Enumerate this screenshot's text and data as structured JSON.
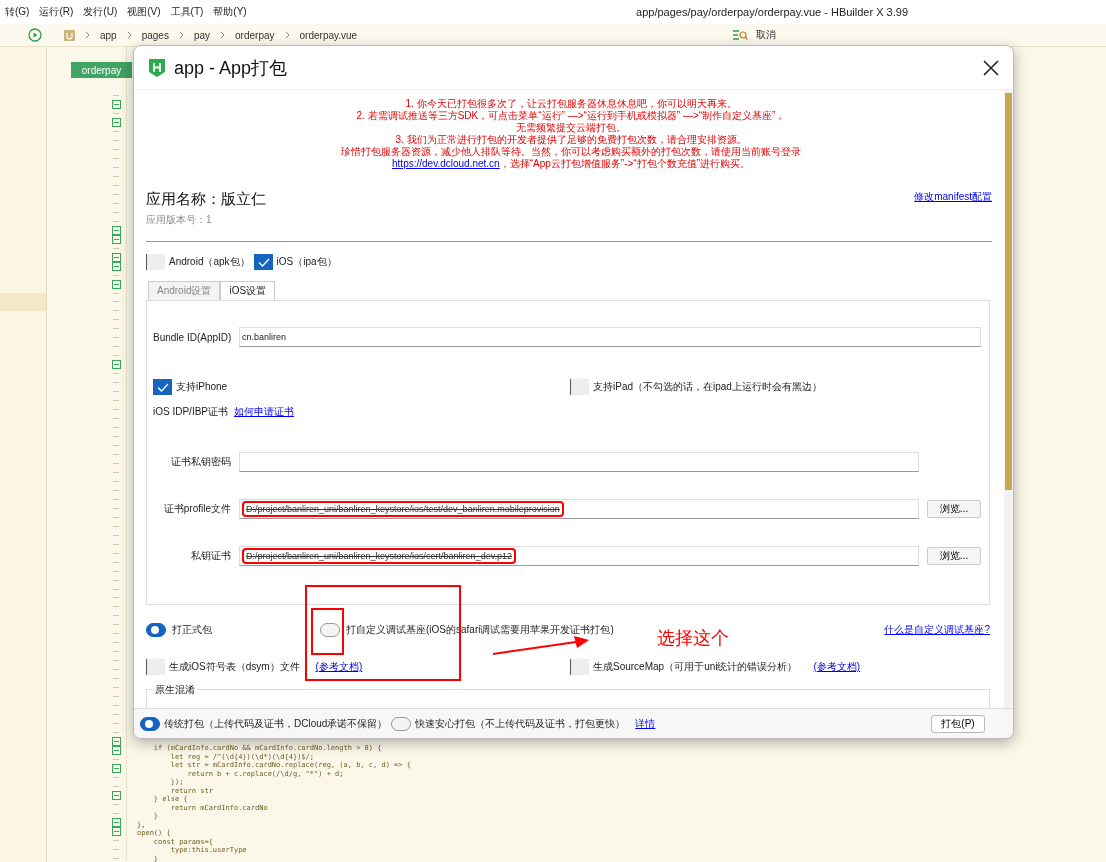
{
  "window": {
    "title": "app/pages/pay/orderpay/orderpay.vue - HBuilder X 3.99"
  },
  "menu": [
    "转(G)",
    "运行(R)",
    "发行(U)",
    "视图(V)",
    "工具(T)",
    "帮助(Y)"
  ],
  "breadcrumb": [
    "app",
    "pages",
    "pay",
    "orderpay",
    "orderpay.vue"
  ],
  "toolbar": {
    "cancel": "取消"
  },
  "editor": {
    "tab": "orderpay",
    "code": [
      "    if (mCardInfo.cardNo && mCardInfo.cardNo.length > 8) {",
      "        let reg = /^(\\d{4})(\\d*)(\\d{4})$/;",
      "        let str = mCardInfo.cardNo.replace(reg, (a, b, c, d) => {",
      "            return b + c.replace(/\\d/g, \"*\") + d;",
      "        });",
      "        return str",
      "    } else {",
      "        return mCardInfo.cardNo",
      "    }",
      "},",
      "open() {",
      "    const params={",
      "        type:this.userType",
      "    }"
    ]
  },
  "dialog": {
    "title": "app - App打包",
    "notice": [
      "1. 你今天已打包很多次了，让云打包服务器休息休息吧，你可以明天再来。",
      "2. 若需调试推送等三方SDK，可点击菜单“运行” —>“运行到手机或模拟器” —>“制作自定义基座”，",
      "无需频繁提交云端打包。",
      "3. 我们为正常进行打包的开发者提供了足够的免费打包次数，请合理安排资源。",
      "珍惜打包服务器资源，减少他人排队等待。当然，你可以考虑购买额外的打包次数，请使用当前账号登录"
    ],
    "notice_link": {
      "link": "https://dev.dcloud.net.cn",
      "text": "，选择“App云打包增值服务”->“打包个数充值”进行购买。"
    },
    "app_name": "应用名称：版立仁",
    "app_version": "应用版本号：1",
    "manifest_link": "修改manifest配置",
    "platforms": [
      {
        "label": "Android（apk包）",
        "checked": false
      },
      {
        "label": "iOS（ipa包）",
        "checked": true
      }
    ],
    "tabs": [
      {
        "label": "Android设置",
        "selected": false
      },
      {
        "label": "iOS设置",
        "selected": true
      }
    ],
    "bundle_id": {
      "label": "Bundle ID(AppID)",
      "value": "cn.banliren"
    },
    "devices": [
      {
        "label": "支持iPhone",
        "checked": true
      },
      {
        "label": "支持iPad（不勾选的话，在ipad上运行时会有黑边）",
        "checked": false
      }
    ],
    "certificate": {
      "label": "iOS IDP/IBP证书",
      "link": "如何申请证书"
    },
    "fields": [
      {
        "label": "证书私钥密码"
      },
      {
        "label": "证书profile文件",
        "value": "D:/project/banliren_uni/banliren_keystore/ios/test/dev_banliren.mobileprovision",
        "highlighted": true,
        "button": "浏览..."
      },
      {
        "label": "私钥证书",
        "value": "D:/project/banliren_uni/banliren_keystore/ios/cert/banliren_dev.p12",
        "highlighted": true,
        "button": "浏览..."
      }
    ],
    "build_types": [
      {
        "label": "打正式包",
        "selected": true
      },
      {
        "label": "打自定义调试基座(iOS的safari调试需要用苹果开发证书打包)",
        "selected": false
      }
    ],
    "build_help_link": "什么是自定义调试基座?",
    "extras": [
      {
        "label": "生成iOS符号表（dsym）文件",
        "link": "(参考文档)",
        "checked": false
      },
      {
        "label": "生成SourceMap（可用于uni统计的错误分析）",
        "link": "(参考文档)",
        "checked": false
      }
    ],
    "obfuscation": {
      "legend": "原生混淆"
    },
    "upload_modes": [
      {
        "label": "传统打包（上传代码及证书，DCloud承诺不保留）",
        "selected": true
      },
      {
        "label": "快速安心打包（不上传代码及证书，打包更快）",
        "selected": false
      }
    ],
    "details_link": "详情",
    "pack_button": "打包(P)"
  },
  "annotations": [
    {
      "kind": "box"
    },
    {
      "kind": "box"
    },
    {
      "kind": "arrow"
    },
    {
      "kind": "label",
      "text": "选择这个"
    }
  ]
}
